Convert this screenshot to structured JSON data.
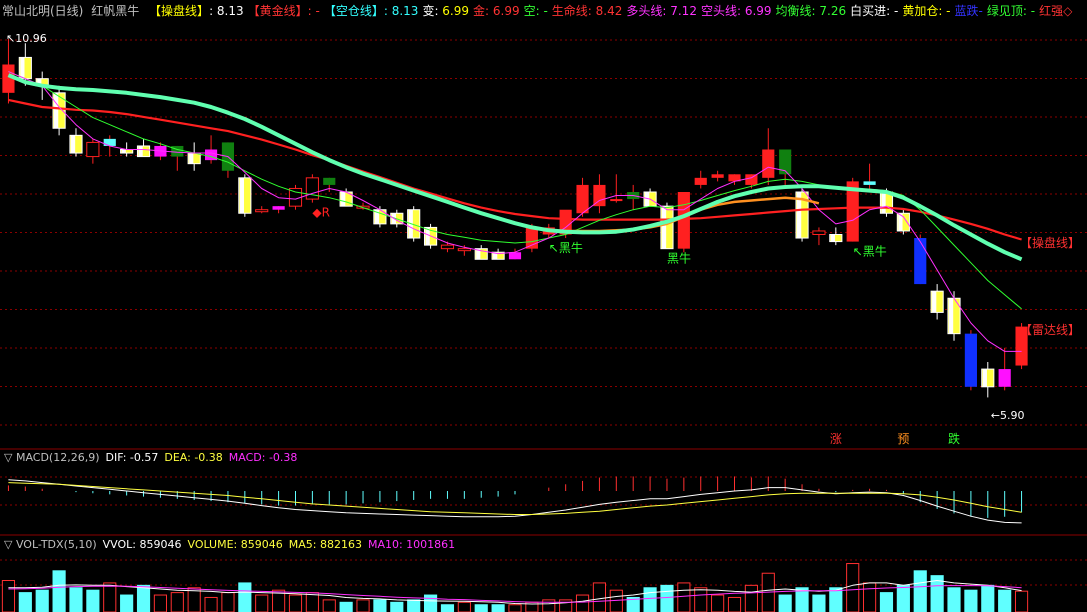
{
  "header": {
    "symbol": "常山北明(日线)",
    "formula": "红帆黑牛",
    "items": [
      {
        "label": "【操盘线】",
        "label_color": "#ffff00",
        "value": ": 8.13",
        "value_color": "#ffffff"
      },
      {
        "label": "【黄金线】",
        "label_color": "#ff3333",
        "value": ": -",
        "value_color": "#ff3333"
      },
      {
        "label": "【空仓线】",
        "label_color": "#33ffff",
        "value": ": 8.13",
        "value_color": "#33ffff"
      },
      {
        "label": "变: ",
        "label_color": "#ffffff",
        "value": "6.99",
        "value_color": "#ffff00"
      },
      {
        "label": "金: ",
        "label_color": "#ff3333",
        "value": "6.99",
        "value_color": "#ff3333"
      },
      {
        "label": "空: ",
        "label_color": "#33ff33",
        "value": "-",
        "value_color": "#33ff33"
      },
      {
        "label": "生命线: ",
        "label_color": "#ff3333",
        "value": "8.42",
        "value_color": "#ff3333"
      },
      {
        "label": "多头线: ",
        "label_color": "#ff33ff",
        "value": "7.12",
        "value_color": "#ff33ff"
      },
      {
        "label": "空头线: ",
        "label_color": "#ff33ff",
        "value": "6.99",
        "value_color": "#ff33ff"
      },
      {
        "label": "均衡线: ",
        "label_color": "#33ff33",
        "value": "7.26",
        "value_color": "#33ff33"
      },
      {
        "label": "白买进: ",
        "label_color": "#ffffff",
        "value": "-",
        "value_color": "#ffffff"
      },
      {
        "label": "黄加仓: ",
        "label_color": "#ffff00",
        "value": "-",
        "value_color": "#ffff00"
      },
      {
        "label": "蓝跌",
        "label_color": "#3333ff",
        "value": "-",
        "value_color": "#3333ff"
      },
      {
        "label": "绿见顶: ",
        "label_color": "#33ff33",
        "value": "-",
        "value_color": "#33ff33"
      },
      {
        "label": "红强◇",
        "label_color": "#ff3333",
        "value": "",
        "value_color": "#ff3333"
      }
    ]
  },
  "colors": {
    "grid": "#8b0000",
    "up": "#ff2020",
    "down_fill": "#ffff40",
    "blue_fill": "#1030ff",
    "magenta_fill": "#ff10ff",
    "cyan_fill": "#60ffff",
    "green_fill": "#108010",
    "caopan": "#60ffb0",
    "shengming": "#ff2020",
    "jinheng": "#30ff30",
    "duotou": "#ff30ff",
    "orange": "#ff9020"
  },
  "price_panel": {
    "high_label": "10.96",
    "low_label": "5.90",
    "right_labels": [
      "【操盘线】",
      "【雷达线】"
    ],
    "annotations": [
      {
        "text": "↖黑牛",
        "color": "#30ff30",
        "bar": 32
      },
      {
        "text": "黑牛",
        "color": "#30ff30",
        "bar": 39
      },
      {
        "text": "↖黑牛",
        "color": "#30ff30",
        "bar": 50
      },
      {
        "text": "◆R",
        "color": "#ff2020",
        "bar": 18
      }
    ],
    "signals": [
      {
        "text": "涨",
        "color": "#ff3030",
        "bar": 49
      },
      {
        "text": "预",
        "color": "#ff9020",
        "bar": 53
      },
      {
        "text": "跌",
        "color": "#30ff30",
        "bar": 56
      }
    ]
  },
  "macd_panel": {
    "title": "MACD(12,26,9)",
    "dif_label": "DIF: -0.57",
    "dea_label": "DEA: -0.38",
    "macd_label": "MACD: -0.38"
  },
  "vol_panel": {
    "title": "VOL-TDX(5,10)",
    "vvol_label": "VVOL: 859046",
    "volume_label": "VOLUME: 859046",
    "ma5_label": "MA5: 882163",
    "ma10_label": "MA10: 1001861"
  },
  "chart_data": {
    "type": "candlestick",
    "ylim": [
      5.2,
      11.2
    ],
    "bars": [
      {
        "o": 10.2,
        "h": 10.96,
        "l": 10.05,
        "c": 10.6,
        "f": "up"
      },
      {
        "o": 10.7,
        "h": 10.9,
        "l": 10.3,
        "c": 10.4,
        "f": "down"
      },
      {
        "o": 10.4,
        "h": 10.5,
        "l": 10.1,
        "c": 10.3,
        "f": "down"
      },
      {
        "o": 10.2,
        "h": 10.3,
        "l": 9.6,
        "c": 9.7,
        "f": "down"
      },
      {
        "o": 9.6,
        "h": 9.7,
        "l": 9.3,
        "c": 9.35,
        "f": "down"
      },
      {
        "o": 9.5,
        "h": 9.55,
        "l": 9.2,
        "c": 9.3,
        "f": "upo"
      },
      {
        "o": 9.45,
        "h": 9.6,
        "l": 9.3,
        "c": 9.55,
        "f": "cyan"
      },
      {
        "o": 9.4,
        "h": 9.5,
        "l": 9.3,
        "c": 9.35,
        "f": "down"
      },
      {
        "o": 9.45,
        "h": 9.55,
        "l": 9.3,
        "c": 9.3,
        "f": "down"
      },
      {
        "o": 9.3,
        "h": 9.5,
        "l": 9.25,
        "c": 9.45,
        "f": "magenta"
      },
      {
        "o": 9.3,
        "h": 9.45,
        "l": 9.1,
        "c": 9.45,
        "f": "green"
      },
      {
        "o": 9.2,
        "h": 9.5,
        "l": 9.1,
        "c": 9.35,
        "f": "down"
      },
      {
        "o": 9.25,
        "h": 9.6,
        "l": 9.2,
        "c": 9.4,
        "f": "magenta"
      },
      {
        "o": 9.1,
        "h": 9.5,
        "l": 9.0,
        "c": 9.5,
        "f": "green"
      },
      {
        "o": 9.0,
        "h": 9.05,
        "l": 8.45,
        "c": 8.5,
        "f": "down"
      },
      {
        "o": 8.55,
        "h": 8.6,
        "l": 8.5,
        "c": 8.55,
        "f": "upo"
      },
      {
        "o": 8.55,
        "h": 8.6,
        "l": 8.5,
        "c": 8.6,
        "f": "magenta"
      },
      {
        "o": 8.6,
        "h": 8.9,
        "l": 8.55,
        "c": 8.85,
        "f": "upo"
      },
      {
        "o": 8.7,
        "h": 9.05,
        "l": 8.65,
        "c": 9.0,
        "f": "upo"
      },
      {
        "o": 8.9,
        "h": 9.0,
        "l": 8.8,
        "c": 9.0,
        "f": "green"
      },
      {
        "o": 8.8,
        "h": 8.85,
        "l": 8.6,
        "c": 8.6,
        "f": "down"
      },
      {
        "o": 8.6,
        "h": 8.65,
        "l": 8.55,
        "c": 8.6,
        "f": "upo"
      },
      {
        "o": 8.55,
        "h": 8.6,
        "l": 8.3,
        "c": 8.35,
        "f": "down"
      },
      {
        "o": 8.5,
        "h": 8.55,
        "l": 8.3,
        "c": 8.35,
        "f": "down"
      },
      {
        "o": 8.55,
        "h": 8.6,
        "l": 8.1,
        "c": 8.15,
        "f": "down"
      },
      {
        "o": 8.3,
        "h": 8.35,
        "l": 8.0,
        "c": 8.05,
        "f": "down"
      },
      {
        "o": 8.05,
        "h": 8.1,
        "l": 7.95,
        "c": 8.0,
        "f": "upo"
      },
      {
        "o": 8.0,
        "h": 8.05,
        "l": 7.9,
        "c": 8.0,
        "f": "upo"
      },
      {
        "o": 8.0,
        "h": 8.05,
        "l": 7.85,
        "c": 7.85,
        "f": "down"
      },
      {
        "o": 7.95,
        "h": 8.0,
        "l": 7.85,
        "c": 7.85,
        "f": "down"
      },
      {
        "o": 7.85,
        "h": 8.0,
        "l": 7.85,
        "c": 7.95,
        "f": "magenta"
      },
      {
        "o": 8.0,
        "h": 8.35,
        "l": 7.95,
        "c": 8.3,
        "f": "up"
      },
      {
        "o": 8.2,
        "h": 8.35,
        "l": 8.15,
        "c": 8.3,
        "f": "up"
      },
      {
        "o": 8.2,
        "h": 8.5,
        "l": 8.15,
        "c": 8.55,
        "f": "up"
      },
      {
        "o": 8.5,
        "h": 9.0,
        "l": 8.45,
        "c": 8.9,
        "f": "up"
      },
      {
        "o": 8.6,
        "h": 9.05,
        "l": 8.5,
        "c": 8.9,
        "f": "up"
      },
      {
        "o": 8.7,
        "h": 9.05,
        "l": 8.65,
        "c": 8.7,
        "f": "up"
      },
      {
        "o": 8.8,
        "h": 8.9,
        "l": 8.55,
        "c": 8.7,
        "f": "green"
      },
      {
        "o": 8.8,
        "h": 8.85,
        "l": 8.6,
        "c": 8.6,
        "f": "down"
      },
      {
        "o": 8.6,
        "h": 8.65,
        "l": 8.0,
        "c": 8.0,
        "f": "down"
      },
      {
        "o": 8.0,
        "h": 8.8,
        "l": 7.95,
        "c": 8.8,
        "f": "up"
      },
      {
        "o": 8.9,
        "h": 9.1,
        "l": 8.85,
        "c": 9.0,
        "f": "up"
      },
      {
        "o": 9.0,
        "h": 9.1,
        "l": 8.95,
        "c": 9.05,
        "f": "up"
      },
      {
        "o": 8.95,
        "h": 9.05,
        "l": 8.9,
        "c": 9.05,
        "f": "up"
      },
      {
        "o": 8.9,
        "h": 9.05,
        "l": 8.85,
        "c": 9.05,
        "f": "up"
      },
      {
        "o": 9.0,
        "h": 9.7,
        "l": 8.9,
        "c": 9.4,
        "f": "up"
      },
      {
        "o": 9.4,
        "h": 9.4,
        "l": 8.9,
        "c": 9.05,
        "f": "green"
      },
      {
        "o": 8.8,
        "h": 8.85,
        "l": 8.1,
        "c": 8.15,
        "f": "down"
      },
      {
        "o": 8.25,
        "h": 8.3,
        "l": 8.05,
        "c": 8.2,
        "f": "upo"
      },
      {
        "o": 8.2,
        "h": 8.3,
        "l": 8.05,
        "c": 8.1,
        "f": "down"
      },
      {
        "o": 8.1,
        "h": 9.0,
        "l": 8.1,
        "c": 8.95,
        "f": "up"
      },
      {
        "o": 8.9,
        "h": 9.2,
        "l": 8.8,
        "c": 8.95,
        "f": "cyan"
      },
      {
        "o": 8.8,
        "h": 8.85,
        "l": 8.45,
        "c": 8.5,
        "f": "down"
      },
      {
        "o": 8.5,
        "h": 8.55,
        "l": 8.2,
        "c": 8.25,
        "f": "down"
      },
      {
        "o": 8.15,
        "h": 8.2,
        "l": 7.5,
        "c": 7.5,
        "f": "blue"
      },
      {
        "o": 7.4,
        "h": 7.5,
        "l": 7.0,
        "c": 7.1,
        "f": "down"
      },
      {
        "o": 7.3,
        "h": 7.4,
        "l": 6.7,
        "c": 6.8,
        "f": "down"
      },
      {
        "o": 6.8,
        "h": 6.85,
        "l": 6.0,
        "c": 6.05,
        "f": "blue"
      },
      {
        "o": 6.3,
        "h": 6.4,
        "l": 5.9,
        "c": 6.05,
        "f": "down"
      },
      {
        "o": 6.3,
        "h": 6.6,
        "l": 6.0,
        "c": 6.05,
        "f": "magenta"
      },
      {
        "o": 6.35,
        "h": 6.95,
        "l": 6.3,
        "c": 6.9,
        "f": "up"
      }
    ],
    "caopan_line": [
      10.45,
      10.35,
      10.3,
      10.27,
      10.25,
      10.24,
      10.22,
      10.2,
      10.17,
      10.14,
      10.1,
      10.06,
      10.0,
      9.92,
      9.83,
      9.72,
      9.6,
      9.48,
      9.36,
      9.25,
      9.15,
      9.06,
      8.98,
      8.9,
      8.82,
      8.74,
      8.66,
      8.58,
      8.5,
      8.43,
      8.36,
      8.3,
      8.26,
      8.24,
      8.23,
      8.23,
      8.24,
      8.27,
      8.32,
      8.38,
      8.46,
      8.56,
      8.66,
      8.74,
      8.8,
      8.85,
      8.87,
      8.88,
      8.88,
      8.86,
      8.84,
      8.82,
      8.8,
      8.72,
      8.6,
      8.47,
      8.33,
      8.2,
      8.07,
      7.95,
      7.85
    ],
    "shengming_line": [
      10.1,
      10.05,
      10.0,
      9.98,
      9.96,
      9.95,
      9.93,
      9.9,
      9.86,
      9.82,
      9.78,
      9.74,
      9.7,
      9.66,
      9.6,
      9.54,
      9.47,
      9.4,
      9.32,
      9.25,
      9.17,
      9.09,
      9.01,
      8.93,
      8.85,
      8.78,
      8.71,
      8.64,
      8.58,
      8.53,
      8.49,
      8.46,
      8.43,
      8.42,
      8.41,
      8.41,
      8.41,
      8.41,
      8.41,
      8.41,
      8.42,
      8.43,
      8.45,
      8.47,
      8.49,
      8.51,
      8.53,
      8.55,
      8.56,
      8.57,
      8.58,
      8.58,
      8.58,
      8.56,
      8.52,
      8.47,
      8.41,
      8.35,
      8.28,
      8.2,
      8.13
    ],
    "jinheng_line": [
      10.5,
      10.4,
      10.3,
      10.15,
      10.0,
      9.85,
      9.75,
      9.65,
      9.55,
      9.48,
      9.4,
      9.35,
      9.3,
      9.22,
      9.1,
      8.98,
      8.88,
      8.8,
      8.76,
      8.72,
      8.66,
      8.58,
      8.5,
      8.42,
      8.34,
      8.26,
      8.2,
      8.16,
      8.12,
      8.1,
      8.08,
      8.1,
      8.15,
      8.2,
      8.3,
      8.4,
      8.48,
      8.55,
      8.6,
      8.58,
      8.62,
      8.68,
      8.75,
      8.82,
      8.88,
      8.95,
      8.98,
      8.95,
      8.9,
      8.86,
      8.85,
      8.84,
      8.82,
      8.75,
      8.55,
      8.3,
      8.05,
      7.8,
      7.55,
      7.35,
      7.15
    ],
    "duotou_line": [
      10.5,
      10.4,
      10.3,
      10.0,
      9.75,
      9.55,
      9.45,
      9.4,
      9.4,
      9.38,
      9.36,
      9.35,
      9.35,
      9.3,
      9.08,
      8.85,
      8.72,
      8.7,
      8.78,
      8.85,
      8.8,
      8.68,
      8.55,
      8.4,
      8.28,
      8.18,
      8.08,
      8.02,
      7.97,
      7.93,
      7.95,
      8.05,
      8.15,
      8.3,
      8.5,
      8.68,
      8.75,
      8.75,
      8.7,
      8.55,
      8.55,
      8.7,
      8.85,
      8.95,
      9.0,
      9.15,
      9.1,
      8.85,
      8.55,
      8.35,
      8.4,
      8.55,
      8.6,
      8.45,
      8.1,
      7.7,
      7.3,
      6.95,
      6.7,
      6.55,
      6.55
    ],
    "orange_line": [
      null,
      null,
      null,
      null,
      null,
      null,
      null,
      null,
      null,
      null,
      null,
      null,
      null,
      null,
      null,
      null,
      null,
      null,
      null,
      null,
      null,
      null,
      null,
      null,
      null,
      null,
      null,
      null,
      null,
      null,
      null,
      null,
      8.25,
      8.25,
      8.25,
      8.25,
      8.26,
      8.27,
      8.3,
      8.35,
      8.45,
      8.55,
      8.62,
      8.66,
      8.68,
      8.7,
      8.72,
      8.7,
      8.64,
      null,
      null,
      null,
      null,
      null,
      null,
      null,
      null,
      null,
      null,
      null,
      null
    ],
    "macd": {
      "ylim": [
        -0.75,
        0.5
      ],
      "dif": [
        0.2,
        0.18,
        0.15,
        0.12,
        0.09,
        0.06,
        0.03,
        0.0,
        -0.03,
        -0.06,
        -0.09,
        -0.12,
        -0.15,
        -0.18,
        -0.22,
        -0.26,
        -0.3,
        -0.33,
        -0.35,
        -0.37,
        -0.39,
        -0.4,
        -0.41,
        -0.42,
        -0.43,
        -0.44,
        -0.45,
        -0.46,
        -0.46,
        -0.46,
        -0.45,
        -0.42,
        -0.38,
        -0.34,
        -0.29,
        -0.24,
        -0.2,
        -0.17,
        -0.14,
        -0.14,
        -0.1,
        -0.06,
        -0.03,
        0.0,
        0.02,
        0.06,
        0.06,
        0.02,
        -0.02,
        -0.05,
        -0.03,
        -0.02,
        -0.03,
        -0.08,
        -0.17,
        -0.27,
        -0.36,
        -0.45,
        -0.52,
        -0.56,
        -0.57
      ],
      "dea": [
        0.15,
        0.14,
        0.13,
        0.12,
        0.1,
        0.08,
        0.06,
        0.04,
        0.02,
        0.0,
        -0.02,
        -0.04,
        -0.06,
        -0.08,
        -0.11,
        -0.14,
        -0.17,
        -0.2,
        -0.23,
        -0.25,
        -0.27,
        -0.29,
        -0.31,
        -0.33,
        -0.35,
        -0.37,
        -0.38,
        -0.39,
        -0.4,
        -0.41,
        -0.42,
        -0.42,
        -0.41,
        -0.4,
        -0.38,
        -0.36,
        -0.33,
        -0.3,
        -0.27,
        -0.25,
        -0.22,
        -0.19,
        -0.16,
        -0.13,
        -0.1,
        -0.07,
        -0.05,
        -0.04,
        -0.04,
        -0.04,
        -0.04,
        -0.04,
        -0.04,
        -0.05,
        -0.07,
        -0.11,
        -0.16,
        -0.22,
        -0.28,
        -0.33,
        -0.38
      ]
    },
    "volume": {
      "ylim": [
        0,
        2600000
      ],
      "values": [
        1300000,
        800000,
        900000,
        1700000,
        1000000,
        900000,
        1200000,
        700000,
        1100000,
        700000,
        800000,
        1000000,
        600000,
        800000,
        1200000,
        700000,
        900000,
        700000,
        800000,
        500000,
        400000,
        500000,
        500000,
        400000,
        500000,
        700000,
        300000,
        400000,
        300000,
        300000,
        300000,
        400000,
        500000,
        500000,
        700000,
        1200000,
        900000,
        600000,
        1000000,
        1100000,
        1200000,
        1000000,
        700000,
        600000,
        1100000,
        1600000,
        700000,
        1000000,
        700000,
        1000000,
        2000000,
        1200000,
        800000,
        1100000,
        1700000,
        1500000,
        1000000,
        900000,
        1100000,
        900000,
        859046
      ],
      "ma5": [
        1000000,
        1000000,
        1020000,
        1100000,
        1120000,
        1100000,
        1100000,
        1050000,
        1000000,
        950000,
        900000,
        880000,
        850000,
        800000,
        820000,
        800000,
        780000,
        750000,
        720000,
        680000,
        600000,
        560000,
        540000,
        500000,
        480000,
        460000,
        450000,
        440000,
        420000,
        400000,
        350000,
        330000,
        340000,
        380000,
        440000,
        550000,
        640000,
        700000,
        800000,
        850000,
        900000,
        920000,
        900000,
        850000,
        820000,
        900000,
        950000,
        900000,
        860000,
        900000,
        1100000,
        1200000,
        1200000,
        1100000,
        1200000,
        1300000,
        1200000,
        1150000,
        1100000,
        1000000,
        882163
      ],
      "ma10": [
        950000,
        960000,
        980000,
        1020000,
        1050000,
        1060000,
        1070000,
        1060000,
        1040000,
        1010000,
        980000,
        950000,
        920000,
        890000,
        870000,
        850000,
        830000,
        810000,
        790000,
        760000,
        720000,
        680000,
        650000,
        610000,
        580000,
        560000,
        530000,
        510000,
        480000,
        460000,
        430000,
        410000,
        400000,
        400000,
        410000,
        440000,
        480000,
        520000,
        560000,
        600000,
        650000,
        700000,
        740000,
        770000,
        790000,
        820000,
        850000,
        870000,
        880000,
        880000,
        920000,
        960000,
        990000,
        1010000,
        1040000,
        1080000,
        1090000,
        1090000,
        1080000,
        1050000,
        1001861
      ]
    }
  }
}
